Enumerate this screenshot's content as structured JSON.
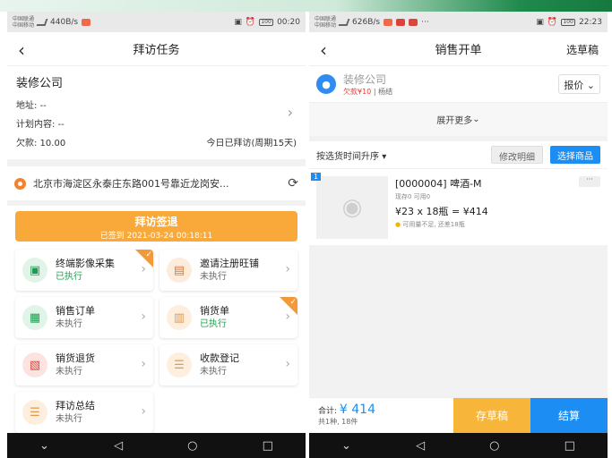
{
  "phone1": {
    "status": {
      "carrier": "中国联通",
      "carrier2": "中国移动",
      "speed": "440B/s",
      "time": "00:20",
      "battery": "100"
    },
    "nav": {
      "back_icon": "chevron-left-icon",
      "title": "拜访任务"
    },
    "customer": {
      "name": "装修公司",
      "address": "地址: --",
      "plan": "计划内容: --",
      "debt": "欠款: 10.00",
      "visit_info": "今日已拜访(周期15天)"
    },
    "location": {
      "text": "北京市海淀区永泰庄东路001号靠近龙岗安..."
    },
    "signout": {
      "title": "拜访签退",
      "subtitle": "已签到 2021-03-24 00:18:11"
    },
    "tiles": [
      {
        "label": "终端影像采集",
        "status": "已执行",
        "done": true,
        "icon": "image-icon",
        "color": "green",
        "badge": true
      },
      {
        "label": "邀请注册旺铺",
        "status": "未执行",
        "done": false,
        "icon": "store-icon",
        "color": "orange",
        "badge": false
      },
      {
        "label": "销售订单",
        "status": "未执行",
        "done": false,
        "icon": "order-icon",
        "color": "green",
        "badge": false
      },
      {
        "label": "销货单",
        "status": "已执行",
        "done": true,
        "icon": "receipt-icon",
        "color": "peach",
        "badge": true
      },
      {
        "label": "销货退货",
        "status": "未执行",
        "done": false,
        "icon": "return-icon",
        "color": "red",
        "badge": false
      },
      {
        "label": "收款登记",
        "status": "未执行",
        "done": false,
        "icon": "payment-icon",
        "color": "peach",
        "badge": false
      },
      {
        "label": "拜访总结",
        "status": "未执行",
        "done": false,
        "icon": "summary-icon",
        "color": "peach",
        "badge": false
      }
    ]
  },
  "phone2": {
    "status": {
      "carrier": "中国联通",
      "carrier2": "中国移动",
      "speed": "626B/s",
      "time": "22:23",
      "battery": "100"
    },
    "nav": {
      "title": "销售开单",
      "right": "选草稿"
    },
    "customer": {
      "name": "装修公司",
      "debt": "欠款¥10",
      "tag": "| 杨结",
      "price_mode": "报价"
    },
    "expand": "展开更多",
    "sort": {
      "label": "按选货时间升序",
      "edit_btn": "修改明细",
      "pick_btn": "选择商品"
    },
    "product": {
      "index": "1",
      "name": "[0000004] 啤酒-M",
      "stock": "现存0  可用0",
      "price": "¥23 x 18瓶 = ¥414",
      "warning": "可用量不足, 还差18瓶"
    },
    "footer": {
      "total_label": "合计:",
      "total": "¥ 414",
      "summary": "共1种, 18件",
      "draft": "存草稿",
      "settle": "结算"
    }
  },
  "colors": {
    "accent_blue": "#1c8df2",
    "accent_orange": "#f8a93a",
    "done_green": "#22a04f"
  }
}
